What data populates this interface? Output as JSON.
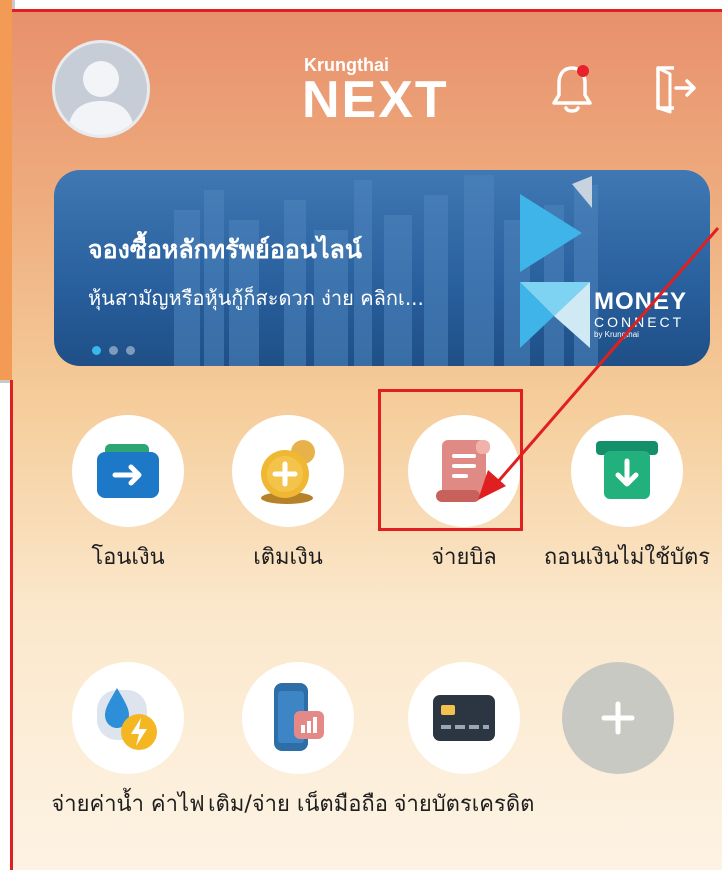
{
  "header": {
    "logo_small": "Krungthai",
    "logo_big": "NEXT"
  },
  "banner": {
    "title": "จองซื้อหลักทรัพย์ออนไลน์",
    "subtitle": "หุ้นสามัญหรือหุ้นกู้ก็สะดวก ง่าย คลิกเ...",
    "partner_name": "MONEY",
    "partner_sub": "CONNECT",
    "partner_by": "by Krungthai",
    "page_count": 3,
    "active_page": 1
  },
  "menu": [
    {
      "label": "โอนเงิน",
      "icon": "transfer-wallet-icon"
    },
    {
      "label": "เติมเงิน",
      "icon": "topup-coin-icon"
    },
    {
      "label": "จ่ายบิล",
      "icon": "bill-scroll-icon"
    },
    {
      "label": "ถอนเงินไม่ใช้บัตร",
      "icon": "cardless-withdraw-icon"
    },
    {
      "label": "จ่ายค่าน้ำ ค่าไฟ",
      "icon": "water-electric-icon"
    },
    {
      "label": "เติม/จ่าย เน็ตมือถือ",
      "icon": "mobile-internet-icon"
    },
    {
      "label": "จ่ายบัตรเครดิต",
      "icon": "credit-card-icon"
    },
    {
      "label": "",
      "icon": "add-plus-icon"
    }
  ],
  "colors": {
    "annotation": "#e02020",
    "banner": "#285f9d",
    "accent_green": "#1a9e6e"
  }
}
